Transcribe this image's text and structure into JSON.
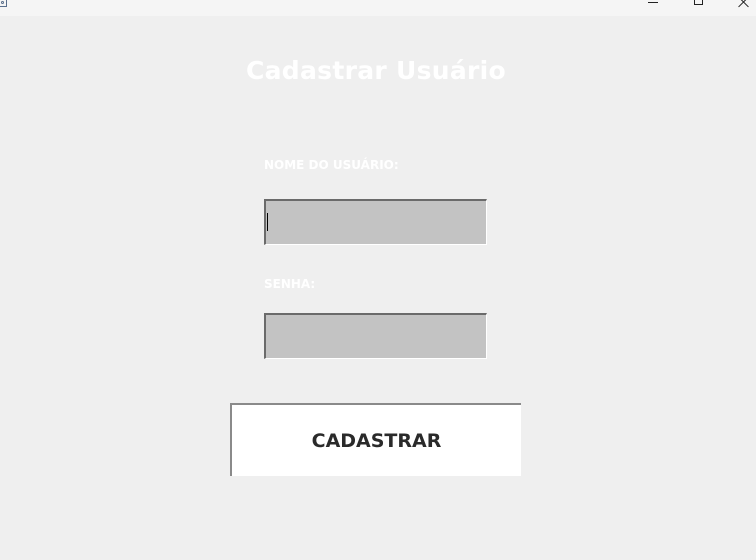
{
  "window": {
    "app_icon": "app-icon",
    "controls": [
      "minimize-icon",
      "maximize-icon",
      "close-icon"
    ]
  },
  "form": {
    "title": "Cadastrar Usuário",
    "username_label": "NOME DO USUÁRIO:",
    "username_value": "",
    "password_label": "SENHA:",
    "password_value": "",
    "submit_label": "CADASTRAR"
  },
  "colors": {
    "background": "#efefef",
    "input_background": "#c3c3c3",
    "label_text": "#ffffff",
    "button_background": "#ffffff",
    "button_text": "#2a2a2a"
  }
}
